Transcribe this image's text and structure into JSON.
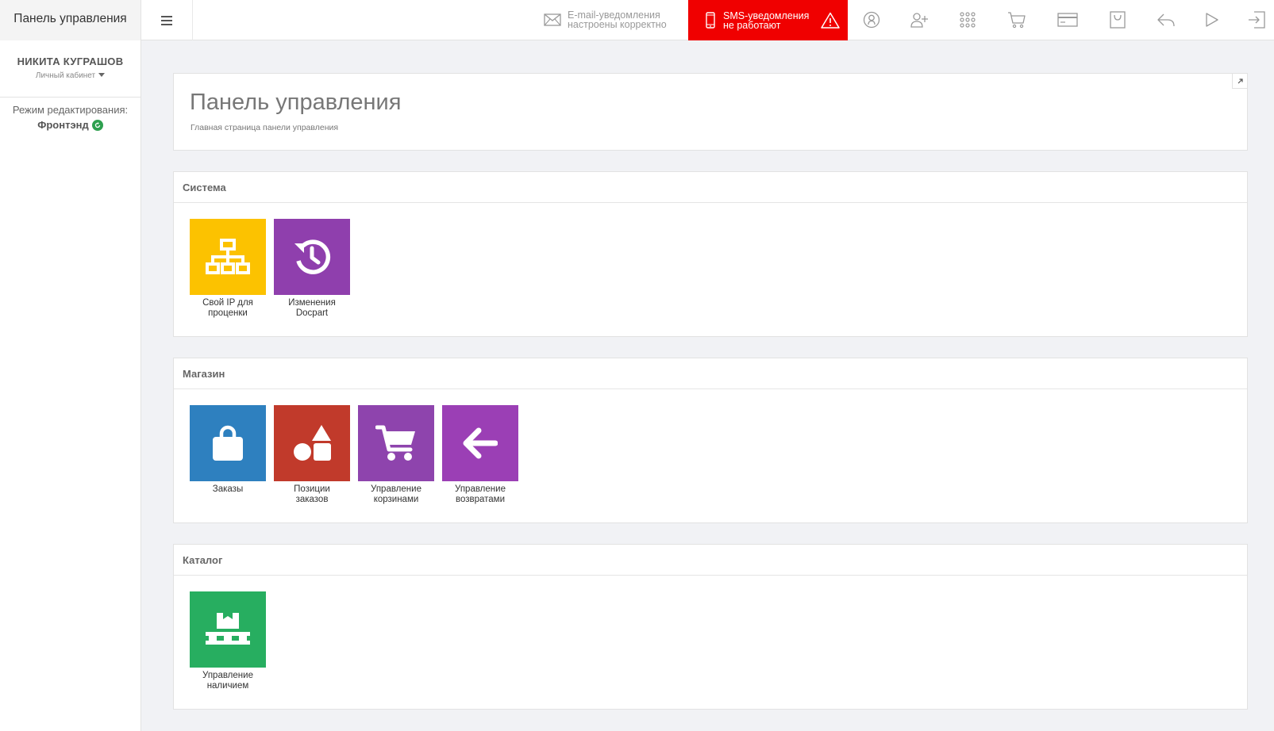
{
  "header": {
    "brand": "Панель управления",
    "email_status": {
      "line1": "E-mail-уведомления",
      "line2": "настроены корректно"
    },
    "sms_alert": {
      "line1": "SMS-уведомления",
      "line2": "не работают"
    },
    "icons": [
      "user-circle-icon",
      "add-user-icon",
      "apps-grid-icon",
      "cart-icon",
      "credit-card-icon",
      "shopping-bag-icon",
      "reply-icon",
      "play-icon",
      "logout-icon"
    ]
  },
  "sidebar": {
    "user_name": "НИКИТА КУГРАШОВ",
    "user_sub": "Личный кабинет",
    "mode_label": "Режим редактирования:",
    "mode_value": "Фронтэнд"
  },
  "main": {
    "title": "Панель управления",
    "subtitle": "Главная страница панели управления",
    "sections": [
      {
        "title": "Система",
        "tiles": [
          {
            "line1": "Свой IP для",
            "line2": "проценки",
            "color": "#fcc200",
            "icon": "network-icon"
          },
          {
            "line1": "Изменения",
            "line2": "Docpart",
            "color": "#8f3fad",
            "icon": "history-icon"
          }
        ]
      },
      {
        "title": "Магазин",
        "tiles": [
          {
            "line1": "Заказы",
            "line2": "",
            "color": "#2e80bf",
            "icon": "shopping-bag-icon"
          },
          {
            "line1": "Позиции",
            "line2": "заказов",
            "color": "#c13a2b",
            "icon": "shapes-icon"
          },
          {
            "line1": "Управление",
            "line2": "корзинами",
            "color": "#8e44ad",
            "icon": "cart-icon"
          },
          {
            "line1": "Управление",
            "line2": "возвратами",
            "color": "#9b3fb5",
            "icon": "arrow-left-icon"
          }
        ]
      },
      {
        "title": "Каталог",
        "tiles": [
          {
            "line1": "Управление",
            "line2": "наличием",
            "color": "#27ae60",
            "icon": "pallet-icon"
          }
        ]
      }
    ]
  }
}
